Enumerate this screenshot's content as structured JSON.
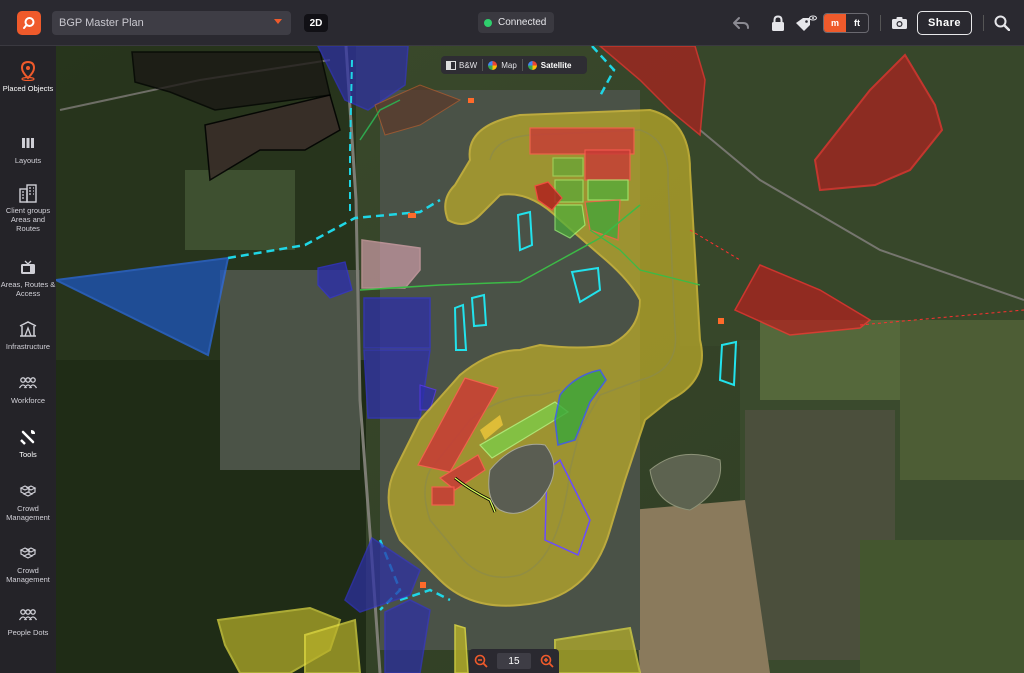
{
  "header": {
    "plan_name": "BGP Master Plan",
    "view_mode": "2D",
    "connection_status": "Connected",
    "status_color": "#2fcf6d",
    "brand_color": "#ef5a2b",
    "units": [
      "m",
      "ft"
    ],
    "active_unit": "m",
    "share_label": "Share",
    "icons": [
      "undo-icon",
      "lock-icon",
      "tag-visibility-icon",
      "camera-icon",
      "search-icon"
    ]
  },
  "sidebar": {
    "items": [
      {
        "label": "Placed Objects",
        "icon": "location-pin-icon",
        "active": true
      },
      {
        "label": "Layouts",
        "icon": "columns-icon"
      },
      {
        "label": "Client groups Areas and Routes",
        "icon": "building-icon"
      },
      {
        "label": "Areas, Routes & Access",
        "icon": "tv-icon"
      },
      {
        "label": "Infrastructure",
        "icon": "tent-icon"
      },
      {
        "label": "Workforce",
        "icon": "people-group-icon"
      },
      {
        "label": "Tools",
        "icon": "wrench-icon"
      },
      {
        "label": "Crowd Management",
        "icon": "cubes-icon"
      },
      {
        "label": "Crowd Management",
        "icon": "cubes-icon"
      },
      {
        "label": "People Dots",
        "icon": "people-dots-icon"
      }
    ]
  },
  "map": {
    "map_types": [
      "B&W",
      "Map",
      "Satellite"
    ],
    "active_map_type": "Satellite",
    "zoom_level": "15"
  }
}
